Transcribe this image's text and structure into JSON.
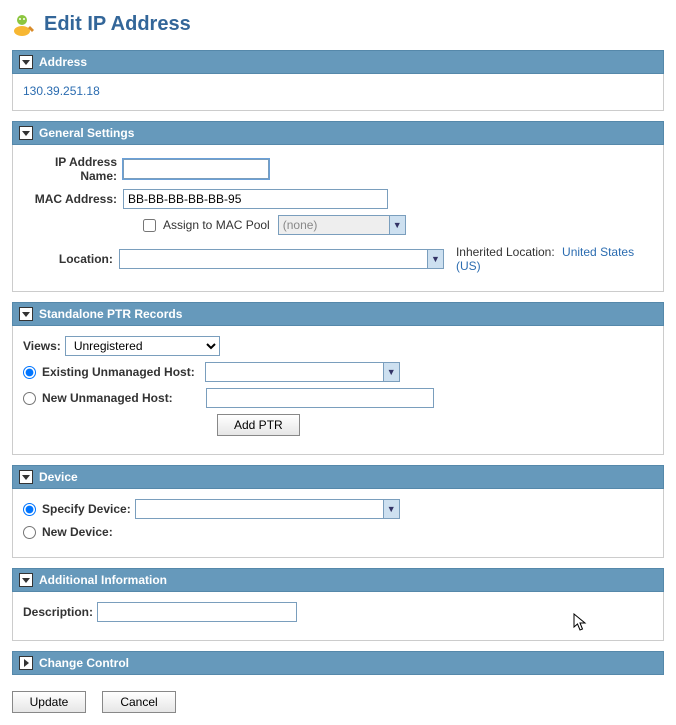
{
  "page": {
    "title": "Edit IP Address"
  },
  "address": {
    "header": "Address",
    "ip": "130.39.251.18"
  },
  "general": {
    "header": "General Settings",
    "ip_name_label": "IP Address Name:",
    "ip_name_value": "",
    "mac_label": "MAC Address:",
    "mac_value": "BB-BB-BB-BB-BB-95",
    "assign_mac_pool_label": "Assign to MAC Pool",
    "mac_pool_value": "(none)",
    "location_label": "Location:",
    "location_value": "",
    "inherited_label": "Inherited Location:",
    "inherited_value": "United States (US)"
  },
  "ptr": {
    "header": "Standalone PTR Records",
    "views_label": "Views:",
    "views_value": "Unregistered",
    "existing_label": "Existing Unmanaged Host:",
    "existing_value": "",
    "new_label": "New Unmanaged Host:",
    "new_value": "",
    "add_btn": "Add PTR"
  },
  "device": {
    "header": "Device",
    "specify_label": "Specify Device:",
    "specify_value": "",
    "new_label": "New Device:"
  },
  "additional": {
    "header": "Additional Information",
    "desc_label": "Description:",
    "desc_value": ""
  },
  "change_control": {
    "header": "Change Control"
  },
  "footer": {
    "update": "Update",
    "cancel": "Cancel"
  }
}
